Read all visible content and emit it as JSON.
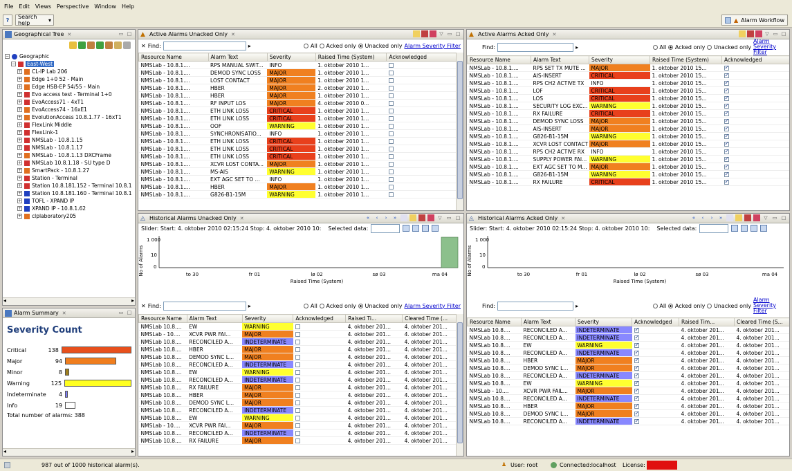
{
  "menu": [
    "File",
    "Edit",
    "Views",
    "Perspective",
    "Window",
    "Help"
  ],
  "toolbar": {
    "search_label": "Search help",
    "workflow_label": "Alarm Workflow"
  },
  "tree": {
    "title": "Geographical Tree",
    "root": "Geographic",
    "selected": "East-West",
    "items": [
      {
        "label": "CL-IP Lab 206",
        "color": "#e07020"
      },
      {
        "label": "Edge 1+0 52 - Main",
        "color": "#e07020"
      },
      {
        "label": "Edge HSB-EP 54/55 - Main",
        "color": "#e07020"
      },
      {
        "label": "Evo access test - Terminal 1+0",
        "color": "#d03030"
      },
      {
        "label": "EvoAccess71 - 4xT1",
        "color": "#d03030"
      },
      {
        "label": "EvoAccess74 - 16xE1",
        "color": "#e07020"
      },
      {
        "label": "EvolutionAccess 10.8.1.77 - 16xT1",
        "color": "#e07020"
      },
      {
        "label": "FlexLink Middle",
        "color": "#d03030"
      },
      {
        "label": "FlexLink-1",
        "color": "#d03030"
      },
      {
        "label": "NMSLab - 10.8.1.15",
        "color": "#d03030"
      },
      {
        "label": "NMSLab - 10.8.1.17",
        "color": "#d03030"
      },
      {
        "label": "NMSLab - 10.8.1.13 DXCFrame",
        "color": "#e07020"
      },
      {
        "label": "NMSLab 10.8.1.18 - SU type D",
        "color": "#d03030"
      },
      {
        "label": "SmartPack - 10.8.1.27",
        "color": "#e07020"
      },
      {
        "label": "Station - Terminal",
        "color": "#d03030"
      },
      {
        "label": "Station 10.8.181.152 - Terminal 10.8.1",
        "color": "#d03030"
      },
      {
        "label": "Station 10.8.181.160 - Terminal 10.8.1",
        "color": "#2040c0"
      },
      {
        "label": "TOFL - XPAND IP",
        "color": "#2040c0"
      },
      {
        "label": "XPAND IP - 10.8.1.62",
        "color": "#2040c0"
      },
      {
        "label": "clplaboratory205",
        "color": "#e07020"
      }
    ]
  },
  "summary": {
    "title": "Alarm Summary",
    "heading": "Severity Count",
    "rows": [
      {
        "label": "Critical",
        "count": "138",
        "value": 138,
        "color": "#e8501c"
      },
      {
        "label": "Major",
        "count": "94",
        "value": 94,
        "color": "#f07e1e"
      },
      {
        "label": "Minor",
        "count": "8",
        "value": 8,
        "color": "#a08020"
      },
      {
        "label": "Warning",
        "count": "125",
        "value": 125,
        "color": "#ffff20"
      },
      {
        "label": "Indeterminate",
        "count": "4",
        "value": 4,
        "color": "#8080ff"
      },
      {
        "label": "Info",
        "count": "19",
        "value": 19,
        "color": "#ffffff"
      }
    ],
    "total": "Total number of alarms: 388"
  },
  "colors": {
    "CRITICAL": "#e8401c",
    "MAJOR": "#f08020",
    "WARNING": "#ffff30",
    "INFO": "#ffffff",
    "INDETERMINATE": "#8888ff"
  },
  "find_label": "Find:",
  "filter_all": "All",
  "filter_acked": "Acked only",
  "filter_unacked": "Unacked only",
  "severity_filter": "Alarm Severity Filter",
  "active_unacked": {
    "title": "Active Alarms Unacked Only",
    "headers": [
      "Resource Name",
      "Alarm Text",
      "Severity",
      "Raised Time (System)",
      "Acknowledged"
    ],
    "rows": [
      [
        "NMSLab - 10.8.1....",
        "RPS MANUAL SWIT...",
        "INFO",
        "1. oktober 2010 1...",
        false
      ],
      [
        "NMSLab - 10.8.1....",
        "DEMOD SYNC LOSS",
        "MAJOR",
        "1. oktober 2010 1...",
        false
      ],
      [
        "NMSLab - 10.8.1....",
        "LOST CONTACT",
        "MAJOR",
        "1. oktober 2010 1...",
        false
      ],
      [
        "NMSLab - 10.8.1....",
        "HBER",
        "MAJOR",
        "2. oktober 2010 1...",
        false
      ],
      [
        "NMSLab - 10.8.1....",
        "HBER",
        "MAJOR",
        "1. oktober 2010 1...",
        false
      ],
      [
        "NMSLab - 10.8.1....",
        "RF INPUT LOS",
        "MAJOR",
        "4. oktober 2010 0...",
        false
      ],
      [
        "NMSLab - 10.8.1....",
        "ETH LINK LOSS",
        "CRITICAL",
        "1. oktober 2010 1...",
        false
      ],
      [
        "NMSLab - 10.8.1....",
        "ETH LINK LOSS",
        "CRITICAL",
        "1. oktober 2010 1...",
        false
      ],
      [
        "NMSLab - 10.8.1....",
        "OOF",
        "WARNING",
        "1. oktober 2010 1...",
        false
      ],
      [
        "NMSLab - 10.8.1....",
        "SYNCHRONISATIO...",
        "INFO",
        "1. oktober 2010 1...",
        false
      ],
      [
        "NMSLab - 10.8.1....",
        "ETH LINK LOSS",
        "CRITICAL",
        "1. oktober 2010 1...",
        false
      ],
      [
        "NMSLab - 10.8.1....",
        "ETH LINK LOSS",
        "CRITICAL",
        "1. oktober 2010 1...",
        false
      ],
      [
        "NMSLab - 10.8.1....",
        "ETH LINK LOSS",
        "CRITICAL",
        "1. oktober 2010 1...",
        false
      ],
      [
        "NMSLab - 10.8.1....",
        "XCVR LOST CONTA...",
        "MAJOR",
        "1. oktober 2010 1...",
        false
      ],
      [
        "NMSLab - 10.8.1....",
        "MS-AIS",
        "WARNING",
        "1. oktober 2010 1...",
        false
      ],
      [
        "NMSLab - 10.8.1....",
        "EXT AGC SET TO ...",
        "INFO",
        "1. oktober 2010 1...",
        false
      ],
      [
        "NMSLab - 10.8.1....",
        "HBER",
        "MAJOR",
        "1. oktober 2010 1...",
        false
      ],
      [
        "NMSLab - 10.8.1....",
        "G826-B1-15M",
        "WARNING",
        "1. oktober 2010 1...",
        false
      ]
    ]
  },
  "active_acked": {
    "title": "Active Alarms Acked Only",
    "headers": [
      "Resource Name",
      "Alarm Text",
      "Severity",
      "Raised Time (System)",
      "Acknowledged"
    ],
    "rows": [
      [
        "NMSLab - 10.8.1....",
        "RPS SET TX MUTE ...",
        "MAJOR",
        "1. oktober 2010 15...",
        true
      ],
      [
        "NMSLab - 10.8.1....",
        "AIS-INSERT",
        "CRITICAL",
        "1. oktober 2010 15...",
        true
      ],
      [
        "NMSLab - 10.8.1....",
        "RPS CH2 ACTIVE TX",
        "INFO",
        "1. oktober 2010 15...",
        true
      ],
      [
        "NMSLab - 10.8.1....",
        "LOF",
        "CRITICAL",
        "1. oktober 2010 15...",
        true
      ],
      [
        "NMSLab - 10.8.1....",
        "LOS",
        "CRITICAL",
        "1. oktober 2010 15...",
        true
      ],
      [
        "NMSLab - 10.8.1....",
        "SECURITY LOG EXC...",
        "WARNING",
        "1. oktober 2010 15...",
        true
      ],
      [
        "NMSLab - 10.8.1....",
        "RX FAILURE",
        "CRITICAL",
        "1. oktober 2010 15...",
        true
      ],
      [
        "NMSLab - 10.8.1....",
        "DEMOD SYNC LOSS",
        "MAJOR",
        "1. oktober 2010 15...",
        true
      ],
      [
        "NMSLab - 10.8.1....",
        "AIS-INSERT",
        "MAJOR",
        "1. oktober 2010 15...",
        true
      ],
      [
        "NMSLab - 10.8.1....",
        "G826-B1-15M",
        "WARNING",
        "1. oktober 2010 15...",
        true
      ],
      [
        "NMSLab - 10.8.1....",
        "XCVR LOST CONTACT",
        "MAJOR",
        "1. oktober 2010 15...",
        true
      ],
      [
        "NMSLab - 10.8.1....",
        "RPS CH2 ACTIVE RX",
        "INFO",
        "1. oktober 2010 15...",
        true
      ],
      [
        "NMSLab - 10.8.1....",
        "SUPPLY POWER FAI...",
        "WARNING",
        "1. oktober 2010 15...",
        true
      ],
      [
        "NMSLab - 10.8.1....",
        "EXT AGC SET TO M...",
        "MAJOR",
        "1. oktober 2010 15...",
        true
      ],
      [
        "NMSLab - 10.8.1....",
        "G826-B1-15M",
        "WARNING",
        "1. oktober 2010 15...",
        true
      ],
      [
        "NMSLab - 10.8.1....",
        "RX FAILURE",
        "CRITICAL",
        "1. oktober 2010 15...",
        true
      ]
    ]
  },
  "hist_unacked": {
    "title": "Historical Alarms Unacked Only",
    "slider": "Slider: Start: 4. oktober 2010 02:15:24  Stop: 4. oktober 2010 10:",
    "selected_label": "Selected data:",
    "headers": [
      "Resource Name",
      "Alarm Text",
      "Severity",
      "Acknowledged",
      "Raised Ti...",
      "Cleared Time (..."
    ],
    "rows": [
      [
        "NMSLab 10.8....",
        "EW",
        "WARNING",
        false,
        "4. oktober 201...",
        "4. oktober 201..."
      ],
      [
        "NMSLab - 10....",
        "XCVR PWR FAI...",
        "MAJOR",
        false,
        "4. oktober 201...",
        "4. oktober 201..."
      ],
      [
        "NMSLab 10.8....",
        "RECONCILED A...",
        "INDETERMINATE",
        false,
        "4. oktober 201...",
        "4. oktober 201..."
      ],
      [
        "NMSLab 10.8....",
        "HBER",
        "MAJOR",
        false,
        "4. oktober 201...",
        "4. oktober 201..."
      ],
      [
        "NMSLab 10.8....",
        "DEMOD SYNC L...",
        "MAJOR",
        false,
        "4. oktober 201...",
        "4. oktober 201..."
      ],
      [
        "NMSLab 10.8....",
        "RECONCILED A...",
        "INDETERMINATE",
        false,
        "4. oktober 201...",
        "4. oktober 201..."
      ],
      [
        "NMSLab 10.8....",
        "EW",
        "WARNING",
        false,
        "4. oktober 201...",
        "4. oktober 201..."
      ],
      [
        "NMSLab 10.8....",
        "RECONCILED A...",
        "INDETERMINATE",
        false,
        "4. oktober 201...",
        "4. oktober 201..."
      ],
      [
        "NMSLab 10.8....",
        "RX FAILURE",
        "MAJOR",
        false,
        "4. oktober 201...",
        "4. oktober 201..."
      ],
      [
        "NMSLab 10.8....",
        "HBER",
        "MAJOR",
        false,
        "4. oktober 201...",
        "4. oktober 201..."
      ],
      [
        "NMSLab 10.8....",
        "DEMOD SYNC L...",
        "MAJOR",
        false,
        "4. oktober 201...",
        "4. oktober 201..."
      ],
      [
        "NMSLab 10.8....",
        "RECONCILED A...",
        "INDETERMINATE",
        false,
        "4. oktober 201...",
        "4. oktober 201..."
      ],
      [
        "NMSLab 10.8....",
        "EW",
        "WARNING",
        false,
        "4. oktober 201...",
        "4. oktober 201..."
      ],
      [
        "NMSLab - 10....",
        "XCVR PWR FAI...",
        "MAJOR",
        false,
        "4. oktober 201...",
        "4. oktober 201..."
      ],
      [
        "NMSLab 10.8....",
        "RECONCILED A...",
        "INDETERMINATE",
        false,
        "4. oktober 201...",
        "4. oktober 201..."
      ],
      [
        "NMSLab 10.8....",
        "RX FAILURE",
        "MAJOR",
        false,
        "4. oktober 201...",
        "4. oktober 201..."
      ]
    ]
  },
  "hist_acked": {
    "title": "Historical Alarms Acked Only",
    "slider": "Slider: Start: 4. oktober 2010 02:15:24  Stop: 4. oktober 2010 10:",
    "selected_label": "Selected data:",
    "headers": [
      "Resource Name",
      "Alarm Text",
      "Severity",
      "Acknowledged",
      "Raised Tim...",
      "Cleared Time (S..."
    ],
    "rows": [
      [
        "NMSLab 10.8....",
        "RECONCILED A...",
        "INDETERMINATE",
        true,
        "4. oktober 201...",
        "4. oktober 201..."
      ],
      [
        "NMSLab 10.8....",
        "RECONCILED A...",
        "INDETERMINATE",
        true,
        "4. oktober 201...",
        "4. oktober 201..."
      ],
      [
        "NMSLab 10.8....",
        "EW",
        "WARNING",
        true,
        "4. oktober 201...",
        "4. oktober 201..."
      ],
      [
        "NMSLab 10.8....",
        "RECONCILED A...",
        "INDETERMINATE",
        true,
        "4. oktober 201...",
        "4. oktober 201..."
      ],
      [
        "NMSLab 10.8....",
        "HBER",
        "MAJOR",
        true,
        "4. oktober 201...",
        "4. oktober 201..."
      ],
      [
        "NMSLab 10.8....",
        "DEMOD SYNC L...",
        "MAJOR",
        true,
        "4. oktober 201...",
        "4. oktober 201..."
      ],
      [
        "NMSLab 10.8....",
        "RECONCILED A...",
        "INDETERMINATE",
        true,
        "4. oktober 201...",
        "4. oktober 201..."
      ],
      [
        "NMSLab 10.8....",
        "EW",
        "WARNING",
        true,
        "4. oktober 201...",
        "4. oktober 201..."
      ],
      [
        "NMSLab - 10....",
        "XCVR PWR FAIL...",
        "MAJOR",
        true,
        "4. oktober 201...",
        "4. oktober 201..."
      ],
      [
        "NMSLab 10.8....",
        "RECONCILED A...",
        "INDETERMINATE",
        true,
        "4. oktober 201...",
        "4. oktober 201..."
      ],
      [
        "NMSLab 10.8....",
        "HBER",
        "MAJOR",
        true,
        "4. oktober 201...",
        "4. oktober 201..."
      ],
      [
        "NMSLab 10.8....",
        "DEMOD SYNC L...",
        "MAJOR",
        true,
        "4. oktober 201...",
        "4. oktober 201..."
      ],
      [
        "NMSLab 10.8....",
        "RECONCILED A...",
        "INDETERMINATE",
        true,
        "4. oktober 201...",
        "4. oktober 201..."
      ]
    ]
  },
  "hist_chart": {
    "ylabel": "No of Alarms",
    "xlabel": "Raised Time (System)",
    "yticks": [
      "1 000",
      "10",
      "0"
    ],
    "xticks": [
      "to 30",
      "fr 01",
      "lø 02",
      "sø 03",
      "ma 04"
    ]
  },
  "status": {
    "historical": "987 out of 1000 historical alarm(s).",
    "user": "User: root",
    "connected": "Connected:localhost",
    "license": "License:"
  }
}
